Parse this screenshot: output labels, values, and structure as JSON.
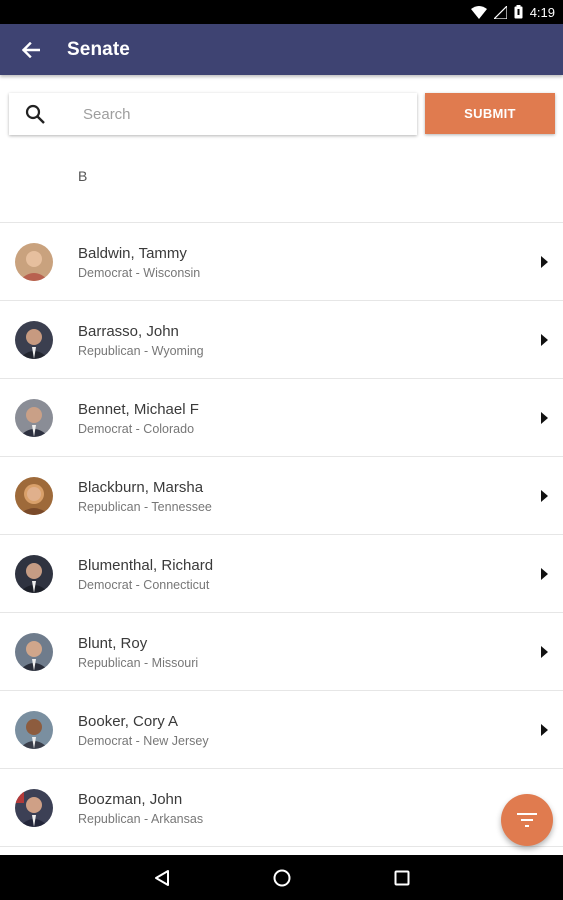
{
  "status_bar": {
    "time": "4:19"
  },
  "app_bar": {
    "title": "Senate"
  },
  "search": {
    "placeholder": "Search",
    "value": ""
  },
  "submit": {
    "label": "SUBMIT"
  },
  "section": {
    "letter": "B"
  },
  "colors": {
    "app_bar": "#3e4372",
    "accent": "#e07b4f"
  },
  "senators": [
    {
      "name": "Baldwin, Tammy",
      "detail": "Democrat - Wisconsin",
      "avatar_bg": "#c9a27e",
      "avatar_fg": "#b8614f"
    },
    {
      "name": "Barrasso, John",
      "detail": "Republican - Wyoming",
      "avatar_bg": "#3b3f4f",
      "avatar_fg": "#c79a80"
    },
    {
      "name": "Bennet, Michael F",
      "detail": "Democrat - Colorado",
      "avatar_bg": "#8a8d96",
      "avatar_fg": "#c9a087"
    },
    {
      "name": "Blackburn, Marsha",
      "detail": "Republican - Tennessee",
      "avatar_bg": "#9e6a3a",
      "avatar_fg": "#e0b08c"
    },
    {
      "name": "Blumenthal, Richard",
      "detail": "Democrat - Connecticut",
      "avatar_bg": "#2f3340",
      "avatar_fg": "#c59c84"
    },
    {
      "name": "Blunt, Roy",
      "detail": "Republican - Missouri",
      "avatar_bg": "#6f7c8c",
      "avatar_fg": "#d0a68b"
    },
    {
      "name": "Booker, Cory A",
      "detail": "Democrat - New Jersey",
      "avatar_bg": "#7a8fa0",
      "avatar_fg": "#8d5c3e"
    },
    {
      "name": "Boozman, John",
      "detail": "Republican - Arkansas",
      "avatar_bg": "#3c4055",
      "avatar_fg": "#cfa086"
    }
  ]
}
